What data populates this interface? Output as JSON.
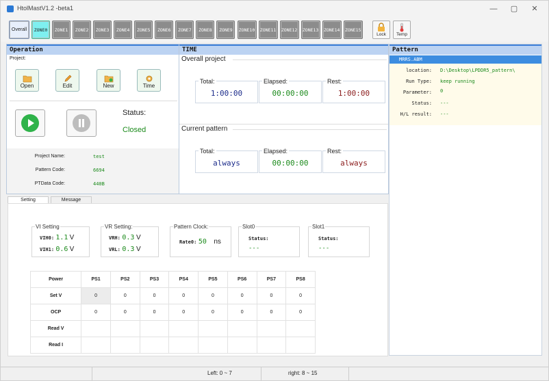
{
  "window": {
    "title": "HtolMastV1.2 -beta1",
    "minimize": "—",
    "maximize": "▢",
    "close": "✕"
  },
  "toolbar": {
    "overall": "Overall",
    "zones": [
      "ZONE0",
      "ZONE1",
      "ZONE2",
      "ZONE3",
      "ZONE4",
      "ZONE5",
      "ZONE6",
      "ZONE7",
      "ZONE8",
      "ZONE9",
      "ZONE10",
      "ZONE11",
      "ZONE12",
      "ZONE13",
      "ZONE14",
      "ZONE15"
    ],
    "active_zone": "ZONE0",
    "lock_label": "Lock",
    "temp_label": "Temp"
  },
  "operation": {
    "header": "Operation",
    "project_label": "Project:",
    "buttons": {
      "open": "Open",
      "edit": "Edit",
      "new": "New",
      "time": "Time"
    },
    "status_label": "Status:",
    "status_value": "Closed",
    "project_name_label": "Project Name:",
    "project_name": "test",
    "pattern_code_label": "Pattern Code:",
    "pattern_code": "6694",
    "ptdata_code_label": "PTData Code:",
    "ptdata_code": "440B"
  },
  "time": {
    "header": "TIME",
    "overall_title": "Overall project",
    "overall": {
      "total_label": "Total:",
      "total": "1:00:00",
      "elapsed_label": "Elapsed:",
      "elapsed": "00:00:00",
      "rest_label": "Rest:",
      "rest": "1:00:00"
    },
    "current_title": "Current pattern",
    "current": {
      "total_label": "Total:",
      "total": "always",
      "elapsed_label": "Elapsed:",
      "elapsed": "00:00:00",
      "rest_label": "Rest:",
      "rest": "always"
    }
  },
  "pattern": {
    "header": "Pattern",
    "selected_file": "MRRS.ABM",
    "location_label": "location:",
    "location": "D:\\Desktop\\LPDDR5_pattern\\",
    "run_type_label": "Run Type:",
    "run_type": "keep running",
    "parameter_label": "Parameter:",
    "parameter": "0",
    "status_label": "Status:",
    "status": "---",
    "hl_label": "H/L result:",
    "hl": "---"
  },
  "tabs": {
    "setting": "Setting",
    "message": "Message"
  },
  "setting": {
    "vi": {
      "title": "VI Setting",
      "vih0_label": "VIH0:",
      "vih0": "1.1",
      "vih1_label": "VIH1:",
      "vih1": "0.6",
      "unit": "V"
    },
    "vr": {
      "title": "VR Setting:",
      "vrh_label": "VRH:",
      "vrh": "0.3",
      "vrl_label": "VRL:",
      "vrl": "0.3",
      "unit": "V"
    },
    "clock": {
      "title": "Pattern Clock:",
      "rate_label": "Rate0:",
      "rate": "50",
      "unit": "ns"
    },
    "slot0": {
      "title": "Slot0",
      "status_label": "Status:",
      "status": "---"
    },
    "slot1": {
      "title": "Slot1",
      "status_label": "Status:",
      "status": "---"
    }
  },
  "power_table": {
    "headers": [
      "Power",
      "PS1",
      "PS2",
      "PS3",
      "PS4",
      "PS5",
      "PS6",
      "PS7",
      "PS8"
    ],
    "rows": [
      {
        "label": "Set V",
        "values": [
          "0",
          "0",
          "0",
          "0",
          "0",
          "0",
          "0",
          "0"
        ]
      },
      {
        "label": "OCP",
        "values": [
          "0",
          "0",
          "0",
          "0",
          "0",
          "0",
          "0",
          "0"
        ]
      },
      {
        "label": "Read V",
        "values": [
          "",
          "",
          "",
          "",
          "",
          "",
          "",
          ""
        ]
      },
      {
        "label": "Read I",
        "values": [
          "",
          "",
          "",
          "",
          "",
          "",
          "",
          ""
        ]
      }
    ]
  },
  "statusbar": {
    "left": "Left: 0 ~ 7",
    "right": "right: 8 ~ 15"
  }
}
